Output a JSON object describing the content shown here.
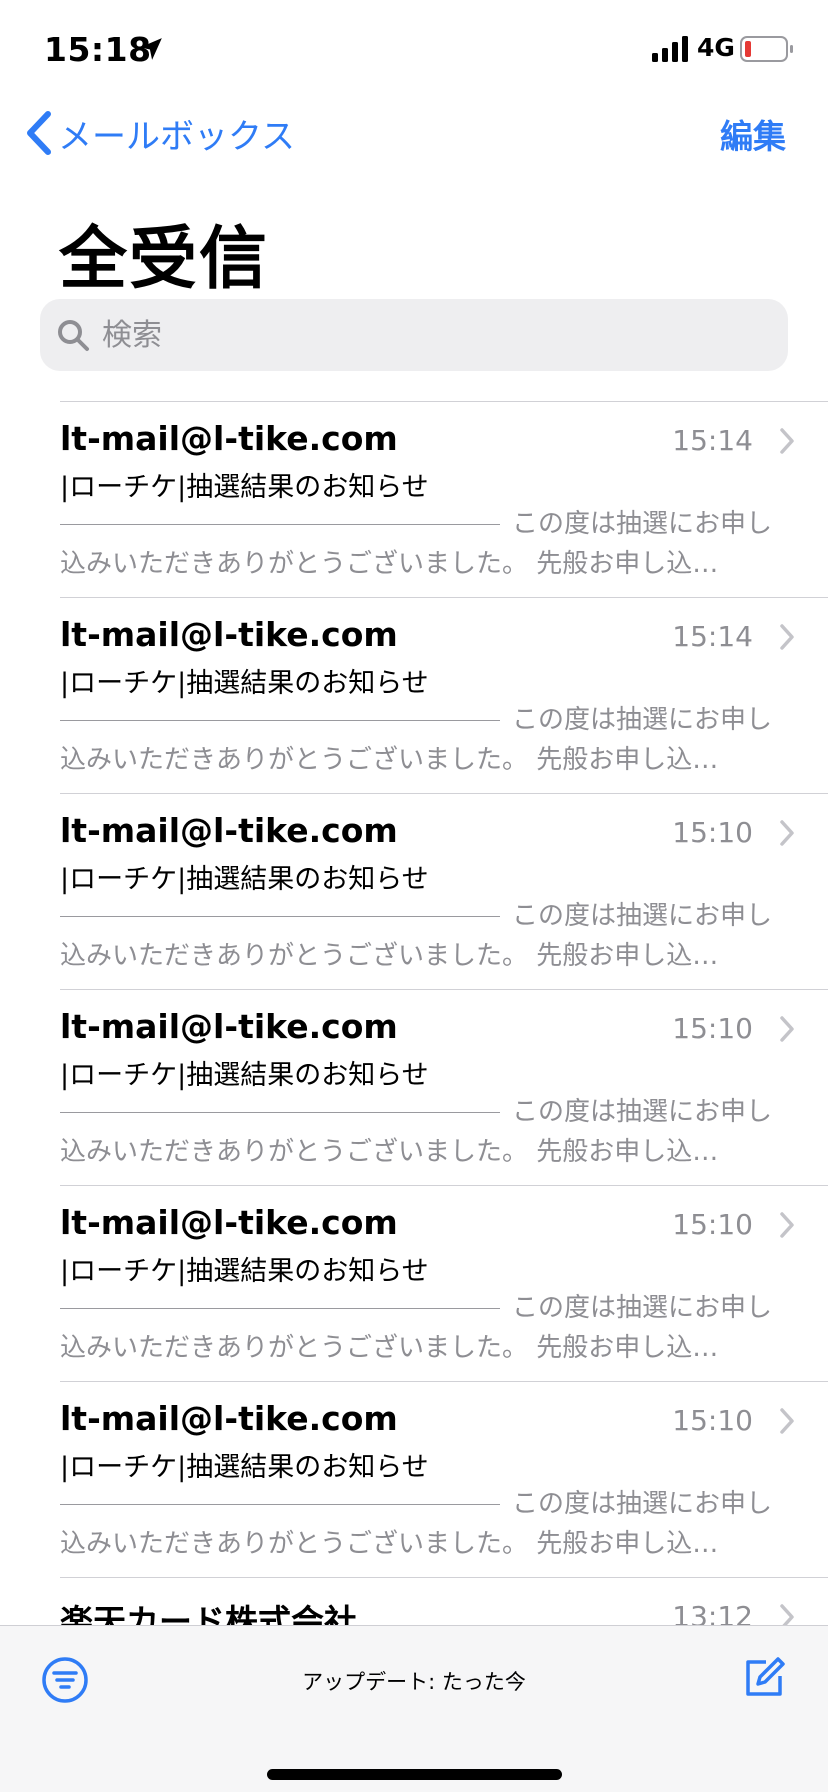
{
  "status_bar": {
    "time": "15:18",
    "network": "4G"
  },
  "nav": {
    "back_label": "メールボックス",
    "edit_label": "編集"
  },
  "page_title": "全受信",
  "search": {
    "placeholder": "検索"
  },
  "mails": [
    {
      "sender": "lt-mail@l-tike.com",
      "time": "15:14",
      "subject": "|ローチケ|抽選結果のお知らせ",
      "preview_line1": "この度は抽選にお申し",
      "preview_line2": "込みいただきありがとうございました。 先般お申し込…"
    },
    {
      "sender": "lt-mail@l-tike.com",
      "time": "15:14",
      "subject": "|ローチケ|抽選結果のお知らせ",
      "preview_line1": "この度は抽選にお申し",
      "preview_line2": "込みいただきありがとうございました。 先般お申し込…"
    },
    {
      "sender": "lt-mail@l-tike.com",
      "time": "15:10",
      "subject": "|ローチケ|抽選結果のお知らせ",
      "preview_line1": "この度は抽選にお申し",
      "preview_line2": "込みいただきありがとうございました。 先般お申し込…"
    },
    {
      "sender": "lt-mail@l-tike.com",
      "time": "15:10",
      "subject": "|ローチケ|抽選結果のお知らせ",
      "preview_line1": "この度は抽選にお申し",
      "preview_line2": "込みいただきありがとうございました。 先般お申し込…"
    },
    {
      "sender": "lt-mail@l-tike.com",
      "time": "15:10",
      "subject": "|ローチケ|抽選結果のお知らせ",
      "preview_line1": "この度は抽選にお申し",
      "preview_line2": "込みいただきありがとうございました。 先般お申し込…"
    },
    {
      "sender": "lt-mail@l-tike.com",
      "time": "15:10",
      "subject": "|ローチケ|抽選結果のお知らせ",
      "preview_line1": "この度は抽選にお申し",
      "preview_line2": "込みいただきありがとうございました。 先般お申し込…"
    },
    {
      "sender": "楽天カード株式会社",
      "time": "13:12",
      "subject": "",
      "preview_line1": "",
      "preview_line2": ""
    }
  ],
  "toolbar": {
    "update_status": "アップデート: たった今"
  },
  "colors": {
    "accent": "#2f7cf6",
    "secondary_text": "#8e8e93",
    "battery_low": "#e53935"
  },
  "icons": {
    "location": "location-arrow-icon",
    "signal": "cellular-signal-icon",
    "battery": "battery-icon",
    "back": "chevron-left-icon",
    "search": "search-icon",
    "row_chevron": "chevron-right-icon",
    "filter": "filter-icon",
    "compose": "compose-icon"
  }
}
